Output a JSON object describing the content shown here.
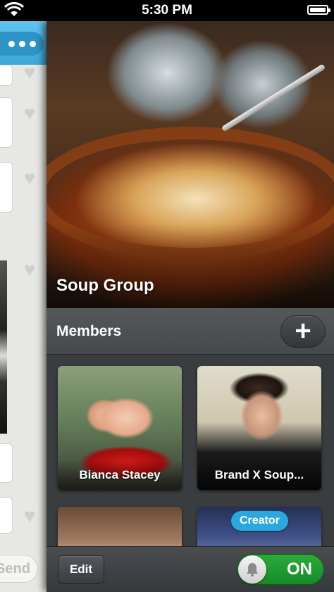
{
  "status_bar": {
    "time": "5:30 PM"
  },
  "background_chat": {
    "send_label": "Send"
  },
  "group": {
    "name": "Soup Group"
  },
  "members_section": {
    "title": "Members",
    "add_label": "+",
    "members": [
      {
        "name": "Bianca Stacey"
      },
      {
        "name": "Brand X Soup..."
      },
      {
        "name": ""
      },
      {
        "name": "",
        "badge": "Creator"
      }
    ]
  },
  "bottom_bar": {
    "edit_label": "Edit",
    "toggle_label": "ON",
    "toggle_on": true
  },
  "colors": {
    "accent_blue": "#3ea7d8",
    "toggle_green": "#1e9a30",
    "panel_dark": "#3a3d40"
  },
  "icons": [
    "wifi-icon",
    "battery-icon",
    "more-dots-icon",
    "heart-icon",
    "plus-icon",
    "bell-icon"
  ]
}
